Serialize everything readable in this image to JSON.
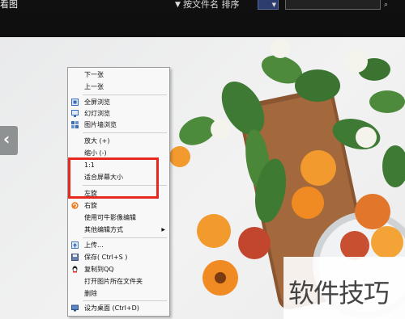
{
  "toolbar": {
    "app_title": "看图",
    "sort_label": "按文件名 排序",
    "sort_icon": "sort-icon",
    "search_icon": "search-icon"
  },
  "context_menu": {
    "items": [
      {
        "label": "下一张"
      },
      {
        "label": "上一张"
      },
      {
        "label": "全屏浏览",
        "icon": "fullscreen-icon"
      },
      {
        "label": "幻灯浏览",
        "icon": "slideshow-icon"
      },
      {
        "label": "图片墙浏览",
        "icon": "image-wall-icon"
      },
      {
        "label": "放大 (+)"
      },
      {
        "label": "缩小 (-)"
      },
      {
        "label": "1:1"
      },
      {
        "label": "适合屏幕大小"
      },
      {
        "label": "左旋"
      },
      {
        "label": "右旋",
        "icon": "rotate-right-icon"
      },
      {
        "label": "使用可牛影像编辑"
      },
      {
        "label": "其他编辑方式",
        "submenu": true
      },
      {
        "label": "上传...",
        "icon": "upload-icon"
      },
      {
        "label": "保存( Ctrl+S )",
        "icon": "save-icon"
      },
      {
        "label": "复制到QQ",
        "icon": "qq-icon"
      },
      {
        "label": "打开图片所在文件夹"
      },
      {
        "label": "删除"
      },
      {
        "label": "设为桌面     (Ctrl+D)",
        "icon": "desktop-icon"
      }
    ]
  },
  "watermark": {
    "text": "软件技巧"
  },
  "colors": {
    "highlight": "#e8281f",
    "menu_bg": "#f8f8f8",
    "topbar_bg": "#101010"
  }
}
